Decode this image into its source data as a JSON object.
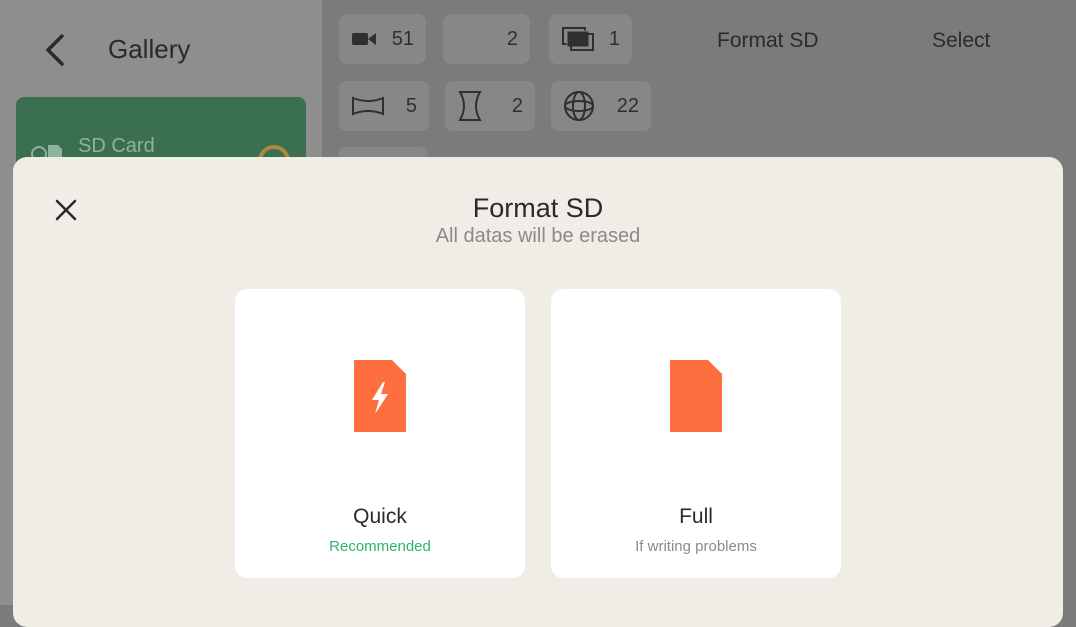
{
  "sidebar": {
    "title": "Gallery",
    "sd_card_label": "SD Card"
  },
  "header": {
    "format_sd_label": "Format SD",
    "select_label": "Select"
  },
  "filters": [
    {
      "icon": "video-icon",
      "count": "51"
    },
    {
      "icon": "blank-icon",
      "count": "2"
    },
    {
      "icon": "stacked-photos-icon",
      "count": "1"
    },
    {
      "icon": "panorama-icon",
      "count": "5"
    },
    {
      "icon": "hourglass-icon",
      "count": "2"
    },
    {
      "icon": "globe-360-icon",
      "count": "22"
    }
  ],
  "modal": {
    "title": "Format SD",
    "subtitle": "All datas will be erased",
    "options": [
      {
        "label": "Quick",
        "sub": "Recommended",
        "sub_color": "#2fb66b",
        "icon": "quick-format-file-icon"
      },
      {
        "label": "Full",
        "sub": "If writing problems",
        "sub_color": "#8a8a88",
        "icon": "full-format-file-icon"
      }
    ]
  },
  "colors": {
    "accent_orange": "#ff6e3f",
    "recommended_green": "#2fb66b",
    "modal_bg": "#f0ede7"
  }
}
